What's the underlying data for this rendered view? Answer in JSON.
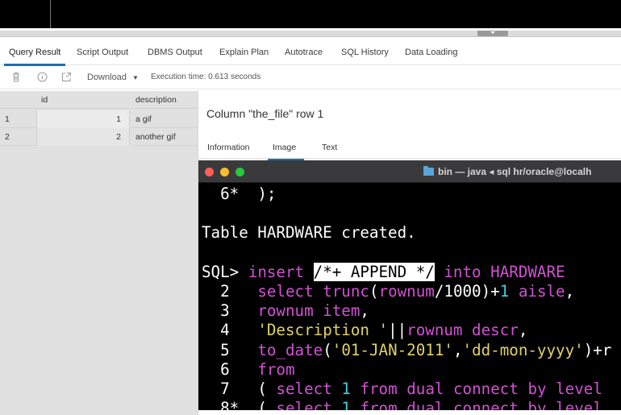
{
  "tabs": [
    "Query Result",
    "Script Output",
    "DBMS Output",
    "Explain Plan",
    "Autotrace",
    "SQL History",
    "Data Loading"
  ],
  "toolbar": {
    "trash_icon": "trash-icon",
    "info_icon": "info-icon",
    "open_external_icon": "open-external-icon",
    "download_label": "Download",
    "download_arrow": "▼",
    "execution_time": "Execution time: 0.613 seconds"
  },
  "grid": {
    "headers": [
      "",
      "id",
      "description"
    ],
    "rows": [
      [
        "1",
        "1",
        "a gif"
      ],
      [
        "2",
        "2",
        "another gif"
      ]
    ]
  },
  "panel": {
    "title": "Column \"the_file\" row 1",
    "tabs": [
      "Information",
      "Image",
      "Text"
    ]
  },
  "terminal": {
    "window_title": "bin — java ◂ sql hr/oracle@localh",
    "lines": {
      "l0_num": "6*",
      "l0_text": "  );",
      "l1": "Table HARDWARE created.",
      "l2_prompt": "SQL> ",
      "l2_insert": "insert ",
      "l2_hint": "/*+ APPEND */",
      "l2_into": " into ",
      "l2_table": "HARDWARE",
      "l3_num": "2",
      "l4_num": "3",
      "l5_num": "4",
      "l6_num": "5",
      "l7_num": "6",
      "l8_num": "7",
      "l9_num": "8*"
    }
  },
  "colors": {
    "accent": "#1c6fb5",
    "keyword": "#d152d2",
    "string": "#e1d26a",
    "number": "#3bd1e0"
  }
}
